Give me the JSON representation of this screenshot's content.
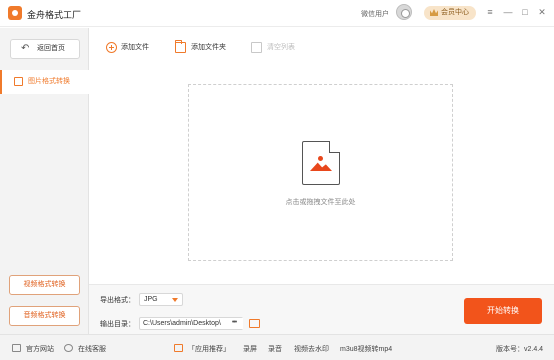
{
  "app": {
    "title": "金舟格式工厂"
  },
  "titlebar": {
    "user_name": "微信用户",
    "vip_label": "会员中心",
    "window_controls": [
      "≡",
      "—",
      "□",
      "✕"
    ]
  },
  "sidebar": {
    "back_label": "返回首页",
    "active_item": "图片格式转换",
    "bottom_buttons": [
      "视频格式转换",
      "音频格式转换"
    ]
  },
  "toolbar": {
    "add_file": "添加文件",
    "add_folder": "添加文件夹",
    "clear_list": "清空列表"
  },
  "dropzone": {
    "hint": "点击或拖拽文件至此处"
  },
  "output": {
    "format_label": "导出格式：",
    "format_value": "JPG",
    "dir_label": "输出目录：",
    "dir_value": "C:\\Users\\admin\\Desktop\\",
    "more_label": "•••"
  },
  "start_button": "开始转换",
  "statusbar": {
    "website": "官方网站",
    "support": "在线客服",
    "recommend": "「应用推荐」",
    "links": [
      "录屏",
      "录音",
      "视频去水印",
      "m3u8视频转mp4"
    ],
    "version": "版本号：v2.4.4"
  },
  "colors": {
    "accent": "#f07a2b",
    "start_button": "#f2541b"
  }
}
